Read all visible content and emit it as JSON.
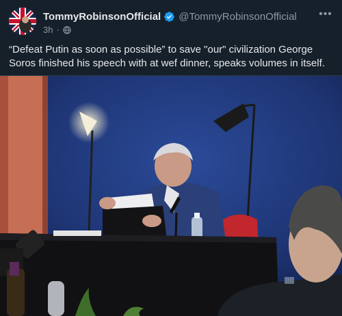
{
  "post": {
    "display_name": "TommyRobinsonOfficial",
    "handle": "@TommyRobinsonOfficial",
    "time": "3h",
    "text": "“Defeat Putin as soon as possible” to save \"our\" civilization George Soros finished his speech with at wef dinner, speaks volumes in itself."
  },
  "icons": {
    "verified": "verified-badge-icon",
    "audience": "globe-icon",
    "more": "more-options-icon"
  },
  "colors": {
    "background": "#15202b",
    "text": "#e7e9ea",
    "muted": "#8b98a5",
    "verified": "#1d9bf0"
  }
}
